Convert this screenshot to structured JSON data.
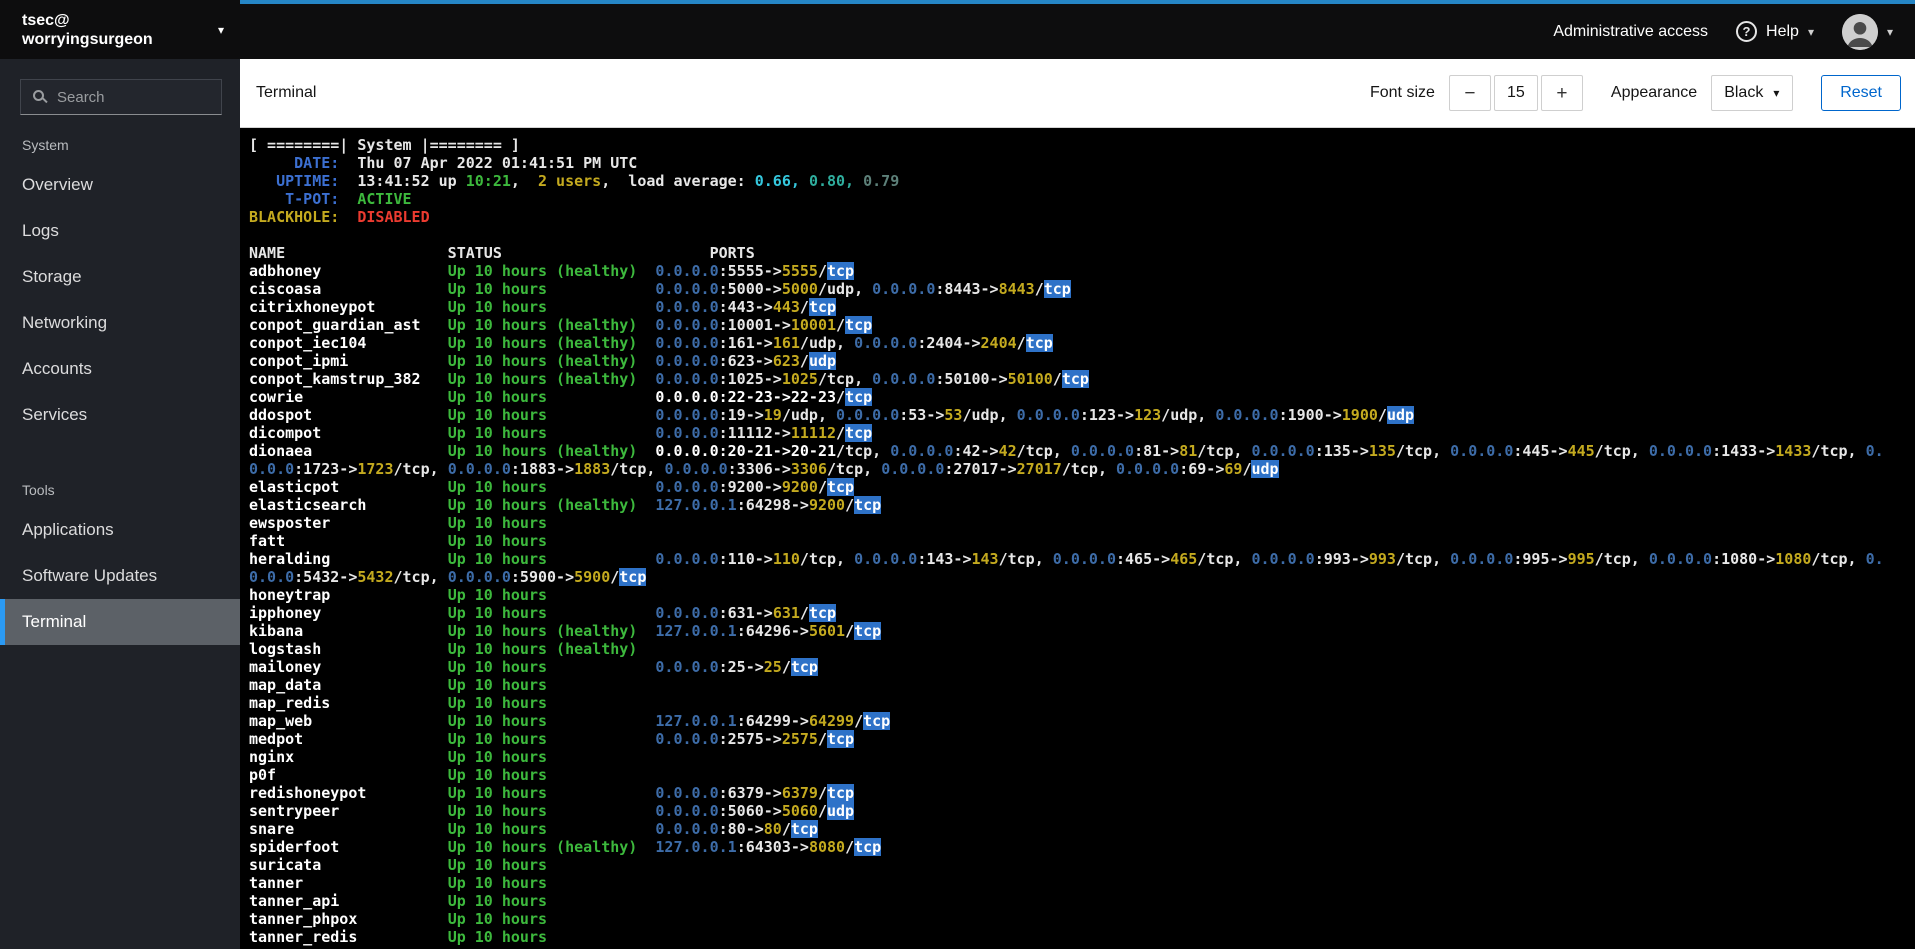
{
  "icons": {
    "chevron_down": "▾",
    "help": "?",
    "minus": "−",
    "plus": "+"
  },
  "masthead": {
    "host_user": "tsec@",
    "host_name": "worryingsurgeon",
    "admin_access_label": "Administrative access",
    "help_label": "Help"
  },
  "sidebar": {
    "search_placeholder": "Search",
    "active_item": "Terminal",
    "sections": [
      {
        "label": "System",
        "items": [
          "Overview",
          "Logs",
          "Storage",
          "Networking",
          "Accounts",
          "Services"
        ]
      },
      {
        "label": "Tools",
        "items": [
          "Applications",
          "Software Updates",
          "Terminal"
        ]
      }
    ]
  },
  "toolbar": {
    "title": "Terminal",
    "font_size_label": "Font size",
    "font_size_value": "15",
    "appearance_label": "Appearance",
    "appearance_value": "Black",
    "reset_label": "Reset"
  },
  "colors": {
    "top_strip": "#2586c6",
    "active_indicator": "#2b9af3",
    "reset_blue": "#0066cc",
    "terminal": {
      "background": "#000000",
      "fg": "#e7e7e7",
      "bright": "#ffffff",
      "green": "#3db93d",
      "yellow": "#c4aa1f",
      "red": "#ec3b30",
      "label_blue": "#3c70d2",
      "ip_blue": "#3d6ca8",
      "cyan": "#35c8de",
      "teal": "#2fae9e",
      "dim": "#5d8079",
      "highlight_bg": "#2e72c8"
    }
  },
  "terminal": {
    "banner": "[ ========| System |======== ]",
    "info_lines": [
      [
        [
          "     DATE:",
          "lbl"
        ],
        [
          "  Thu 07 Apr 2022 01:41:51 PM UTC",
          "fg"
        ]
      ],
      [
        [
          "   UPTIME:",
          "lbl"
        ],
        [
          "  13:41:52 up ",
          "fg"
        ],
        [
          "10:21",
          "grn"
        ],
        [
          ",  ",
          "fg"
        ],
        [
          "2 users",
          "yel"
        ],
        [
          ",  load average: ",
          "fg"
        ],
        [
          "0.66,",
          "cyn"
        ],
        [
          " ",
          "fg"
        ],
        [
          "0.80,",
          "teal"
        ],
        [
          " ",
          "fg"
        ],
        [
          "0.79",
          "dim"
        ]
      ],
      [
        [
          "    T-POT:",
          "lbl"
        ],
        [
          "  ",
          "fg"
        ],
        [
          "ACTIVE",
          "grn"
        ]
      ],
      [
        [
          "BLACKHOLE:",
          "yel"
        ],
        [
          "  ",
          "fg"
        ],
        [
          "DISABLED",
          "red"
        ]
      ]
    ],
    "columns": {
      "name": "NAME",
      "status": "STATUS",
      "ports": "PORTS"
    },
    "rows": [
      {
        "name": "adbhoney",
        "status": "Up 10 hours (healthy)",
        "ports": [
          "0.0.0.0:5555->5555/tcp"
        ]
      },
      {
        "name": "ciscoasa",
        "status": "Up 10 hours",
        "ports": [
          "0.0.0.0:5000->5000/udp",
          "0.0.0.0:8443->8443/tcp"
        ]
      },
      {
        "name": "citrixhoneypot",
        "status": "Up 10 hours",
        "ports": [
          "0.0.0.0:443->443/tcp"
        ]
      },
      {
        "name": "conpot_guardian_ast",
        "status": "Up 10 hours (healthy)",
        "ports": [
          "0.0.0.0:10001->10001/tcp"
        ]
      },
      {
        "name": "conpot_iec104",
        "status": "Up 10 hours (healthy)",
        "ports": [
          "0.0.0.0:161->161/udp",
          "0.0.0.0:2404->2404/tcp"
        ]
      },
      {
        "name": "conpot_ipmi",
        "status": "Up 10 hours (healthy)",
        "ports": [
          "0.0.0.0:623->623/udp"
        ]
      },
      {
        "name": "conpot_kamstrup_382",
        "status": "Up 10 hours (healthy)",
        "ports": [
          "0.0.0.0:1025->1025/tcp",
          "0.0.0.0:50100->50100/tcp"
        ]
      },
      {
        "name": "cowrie",
        "status": "Up 10 hours",
        "ports": [
          "0.0.0.0:22-23->22-23/tcp"
        ]
      },
      {
        "name": "ddospot",
        "status": "Up 10 hours",
        "ports": [
          "0.0.0.0:19->19/udp",
          "0.0.0.0:53->53/udp",
          "0.0.0.0:123->123/udp",
          "0.0.0.0:1900->1900/udp"
        ]
      },
      {
        "name": "dicompot",
        "status": "Up 10 hours",
        "ports": [
          "0.0.0.0:11112->11112/tcp"
        ]
      },
      {
        "name": "dionaea",
        "status": "Up 10 hours (healthy)",
        "ports": [
          "0.0.0.0:20-21->20-21/tcp",
          "0.0.0.0:42->42/tcp",
          "0.0.0.0:81->81/tcp",
          "0.0.0.0:135->135/tcp",
          "0.0.0.0:445->445/tcp",
          "0.0.0.0:1433->1433/tcp",
          "0.0.0.0:1723->1723/tcp",
          "0.0.0.0:1883->1883/tcp",
          "0.0.0.0:3306->3306/tcp",
          "0.0.0.0:27017->27017/tcp",
          "0.0.0.0:69->69/udp"
        ]
      },
      {
        "name": "elasticpot",
        "status": "Up 10 hours",
        "ports": [
          "0.0.0.0:9200->9200/tcp"
        ]
      },
      {
        "name": "elasticsearch",
        "status": "Up 10 hours (healthy)",
        "ports": [
          "127.0.0.1:64298->9200/tcp"
        ]
      },
      {
        "name": "ewsposter",
        "status": "Up 10 hours",
        "ports": []
      },
      {
        "name": "fatt",
        "status": "Up 10 hours",
        "ports": []
      },
      {
        "name": "heralding",
        "status": "Up 10 hours",
        "ports": [
          "0.0.0.0:110->110/tcp",
          "0.0.0.0:143->143/tcp",
          "0.0.0.0:465->465/tcp",
          "0.0.0.0:993->993/tcp",
          "0.0.0.0:995->995/tcp",
          "0.0.0.0:1080->1080/tcp",
          "0.0.0.0:5432->5432/tcp",
          "0.0.0.0:5900->5900/tcp"
        ]
      },
      {
        "name": "honeytrap",
        "status": "Up 10 hours",
        "ports": []
      },
      {
        "name": "ipphoney",
        "status": "Up 10 hours",
        "ports": [
          "0.0.0.0:631->631/tcp"
        ]
      },
      {
        "name": "kibana",
        "status": "Up 10 hours (healthy)",
        "ports": [
          "127.0.0.1:64296->5601/tcp"
        ]
      },
      {
        "name": "logstash",
        "status": "Up 10 hours (healthy)",
        "ports": []
      },
      {
        "name": "mailoney",
        "status": "Up 10 hours",
        "ports": [
          "0.0.0.0:25->25/tcp"
        ]
      },
      {
        "name": "map_data",
        "status": "Up 10 hours",
        "ports": []
      },
      {
        "name": "map_redis",
        "status": "Up 10 hours",
        "ports": []
      },
      {
        "name": "map_web",
        "status": "Up 10 hours",
        "ports": [
          "127.0.0.1:64299->64299/tcp"
        ]
      },
      {
        "name": "medpot",
        "status": "Up 10 hours",
        "ports": [
          "0.0.0.0:2575->2575/tcp"
        ]
      },
      {
        "name": "nginx",
        "status": "Up 10 hours",
        "ports": []
      },
      {
        "name": "p0f",
        "status": "Up 10 hours",
        "ports": []
      },
      {
        "name": "redishoneypot",
        "status": "Up 10 hours",
        "ports": [
          "0.0.0.0:6379->6379/tcp"
        ]
      },
      {
        "name": "sentrypeer",
        "status": "Up 10 hours",
        "ports": [
          "0.0.0.0:5060->5060/udp"
        ]
      },
      {
        "name": "snare",
        "status": "Up 10 hours",
        "ports": [
          "0.0.0.0:80->80/tcp"
        ]
      },
      {
        "name": "spiderfoot",
        "status": "Up 10 hours (healthy)",
        "ports": [
          "127.0.0.1:64303->8080/tcp"
        ]
      },
      {
        "name": "suricata",
        "status": "Up 10 hours",
        "ports": []
      },
      {
        "name": "tanner",
        "status": "Up 10 hours",
        "ports": []
      },
      {
        "name": "tanner_api",
        "status": "Up 10 hours",
        "ports": []
      },
      {
        "name": "tanner_phpox",
        "status": "Up 10 hours",
        "ports": []
      },
      {
        "name": "tanner_redis",
        "status": "Up 10 hours",
        "ports": []
      }
    ]
  }
}
